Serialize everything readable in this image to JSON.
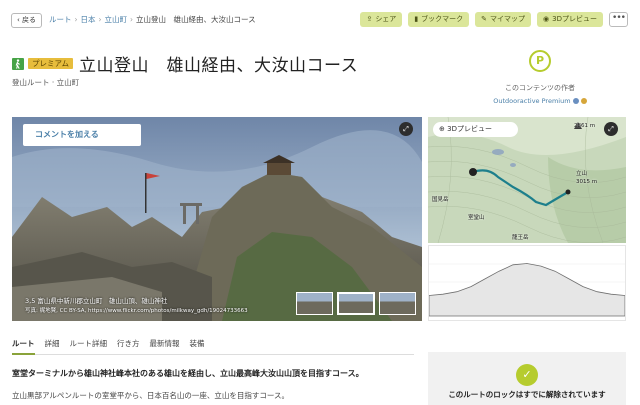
{
  "header": {
    "back_label": "‹ 戻る",
    "breadcrumbs": [
      "ルート",
      "日本",
      "立山町",
      "立山登山　雄山経由、大汝山コース"
    ],
    "separator": "›"
  },
  "actions": [
    {
      "label": "シェア",
      "icon": "share-icon"
    },
    {
      "label": "ブックマーク",
      "icon": "bookmark-icon"
    },
    {
      "label": "マイマップ",
      "icon": "map-icon"
    },
    {
      "label": "3Dプレビュー",
      "icon": "3d-icon"
    }
  ],
  "more_label": "•••",
  "title": {
    "badge": "プレミアム",
    "text": "立山登山　雄山経由、大汝山コース",
    "subtitle": "登山ルート · 立山町",
    "activity_icon": "hiking-icon"
  },
  "author": {
    "logo_letter": "P",
    "caption": "このコンテンツの作者",
    "name": "Outdooractive Premium"
  },
  "photo": {
    "comment_label": "コメントを加える",
    "expand_icon": "expand-icon",
    "caption_line1": "3,5  富山県中新川郡立山町　雄山山頂、雄山神社",
    "caption_line2": "写真: 梶地賢, CC BY-SA, https://www.flickr.com/photos/milkway_gdh/19024733663",
    "thumb_count": 3
  },
  "map": {
    "preview_label": "3Dプレビュー",
    "labels": [
      {
        "text": "国見岳",
        "key": "a"
      },
      {
        "text": "室堂山",
        "key": "b"
      },
      {
        "text": "立山",
        "key": "c"
      },
      {
        "text": "3015 m",
        "key": "d"
      },
      {
        "text": "龍王岳",
        "key": "e"
      },
      {
        "text": "2861 m",
        "key": "f"
      }
    ],
    "colors": {
      "route": "#1d7f8c",
      "terrain": "#c9d9bd"
    }
  },
  "elevation": {
    "profile": [
      0.32,
      0.34,
      0.38,
      0.46,
      0.58,
      0.7,
      0.8,
      0.82,
      0.78,
      0.7,
      0.58,
      0.46,
      0.38,
      0.34,
      0.32
    ]
  },
  "tabs": [
    "ルート",
    "詳細",
    "ルート詳細",
    "行き方",
    "最新情報",
    "装備"
  ],
  "active_tab": 0,
  "lead": "室堂ターミナルから雄山神社峰本社のある雄山を経由し、立山最高峰大汝山山頂を目指すコース。",
  "body": "立山黒部アルペンルートの室堂平から、日本百名山の一座、立山を目指すコース。",
  "lock": {
    "icon": "check-icon",
    "text": "このルートのロックはすでに解除されています"
  }
}
